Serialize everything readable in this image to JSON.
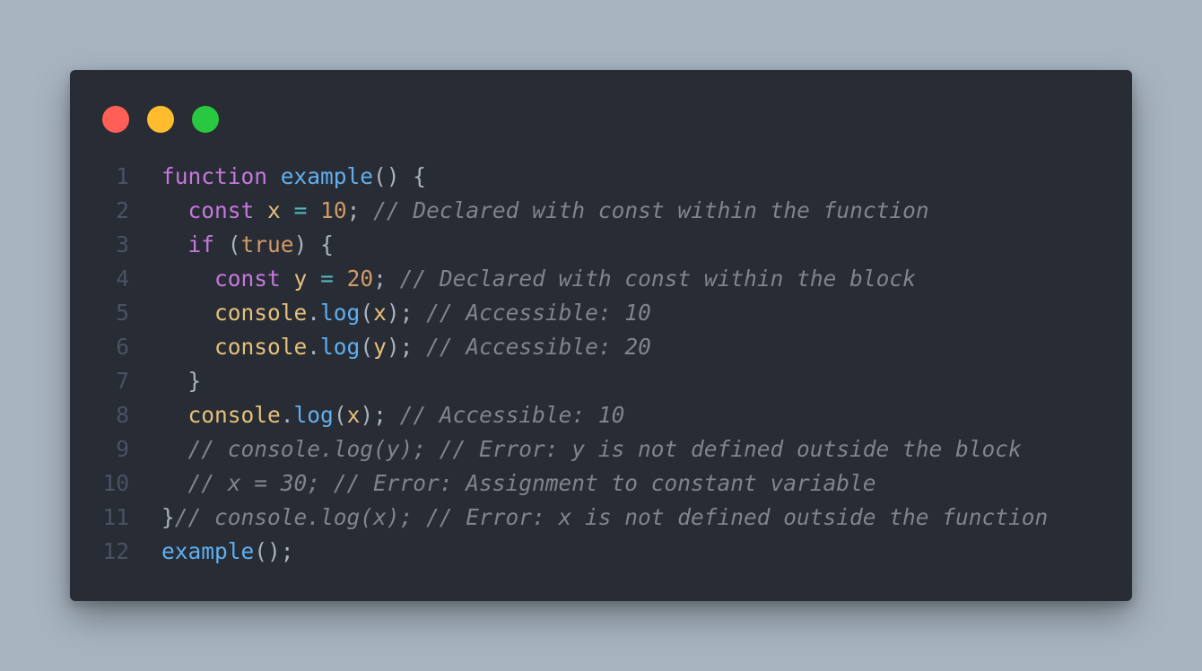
{
  "window_controls": {
    "close_color": "#ff5f57",
    "minimize_color": "#febc2e",
    "maximize_color": "#28c840"
  },
  "theme": {
    "keyword": "#c678dd",
    "function": "#61afef",
    "variable": "#e5c07b",
    "number": "#d19a66",
    "operator": "#56b6c2",
    "plain": "#abb2bf",
    "comment": "#7f848e",
    "line_number": "#4b5263"
  },
  "code": {
    "lines": [
      {
        "number": "1",
        "tokens": [
          {
            "t": "function",
            "k": "keyword"
          },
          {
            "t": " ",
            "k": "plain"
          },
          {
            "t": "example",
            "k": "function"
          },
          {
            "t": "() {",
            "k": "plain"
          }
        ]
      },
      {
        "number": "2",
        "tokens": [
          {
            "t": "  ",
            "k": "plain"
          },
          {
            "t": "const",
            "k": "keyword"
          },
          {
            "t": " ",
            "k": "plain"
          },
          {
            "t": "x",
            "k": "variable"
          },
          {
            "t": " ",
            "k": "plain"
          },
          {
            "t": "=",
            "k": "operator"
          },
          {
            "t": " ",
            "k": "plain"
          },
          {
            "t": "10",
            "k": "number"
          },
          {
            "t": "; ",
            "k": "plain"
          },
          {
            "t": "// Declared with const within the function",
            "k": "comment"
          }
        ]
      },
      {
        "number": "3",
        "tokens": [
          {
            "t": "  ",
            "k": "plain"
          },
          {
            "t": "if",
            "k": "keyword"
          },
          {
            "t": " (",
            "k": "plain"
          },
          {
            "t": "true",
            "k": "number"
          },
          {
            "t": ") {",
            "k": "plain"
          }
        ]
      },
      {
        "number": "4",
        "tokens": [
          {
            "t": "    ",
            "k": "plain"
          },
          {
            "t": "const",
            "k": "keyword"
          },
          {
            "t": " ",
            "k": "plain"
          },
          {
            "t": "y",
            "k": "variable"
          },
          {
            "t": " ",
            "k": "plain"
          },
          {
            "t": "=",
            "k": "operator"
          },
          {
            "t": " ",
            "k": "plain"
          },
          {
            "t": "20",
            "k": "number"
          },
          {
            "t": "; ",
            "k": "plain"
          },
          {
            "t": "// Declared with const within the block",
            "k": "comment"
          }
        ]
      },
      {
        "number": "5",
        "tokens": [
          {
            "t": "    ",
            "k": "plain"
          },
          {
            "t": "console",
            "k": "variable"
          },
          {
            "t": ".",
            "k": "plain"
          },
          {
            "t": "log",
            "k": "function"
          },
          {
            "t": "(",
            "k": "plain"
          },
          {
            "t": "x",
            "k": "variable"
          },
          {
            "t": "); ",
            "k": "plain"
          },
          {
            "t": "// Accessible: 10",
            "k": "comment"
          }
        ]
      },
      {
        "number": "6",
        "tokens": [
          {
            "t": "    ",
            "k": "plain"
          },
          {
            "t": "console",
            "k": "variable"
          },
          {
            "t": ".",
            "k": "plain"
          },
          {
            "t": "log",
            "k": "function"
          },
          {
            "t": "(",
            "k": "plain"
          },
          {
            "t": "y",
            "k": "variable"
          },
          {
            "t": "); ",
            "k": "plain"
          },
          {
            "t": "// Accessible: 20",
            "k": "comment"
          }
        ]
      },
      {
        "number": "7",
        "tokens": [
          {
            "t": "  }",
            "k": "plain"
          }
        ]
      },
      {
        "number": "8",
        "tokens": [
          {
            "t": "  ",
            "k": "plain"
          },
          {
            "t": "console",
            "k": "variable"
          },
          {
            "t": ".",
            "k": "plain"
          },
          {
            "t": "log",
            "k": "function"
          },
          {
            "t": "(",
            "k": "plain"
          },
          {
            "t": "x",
            "k": "variable"
          },
          {
            "t": "); ",
            "k": "plain"
          },
          {
            "t": "// Accessible: 10",
            "k": "comment"
          }
        ]
      },
      {
        "number": "9",
        "tokens": [
          {
            "t": "  ",
            "k": "plain"
          },
          {
            "t": "// console.log(y); // Error: y is not defined outside the block",
            "k": "comment"
          }
        ]
      },
      {
        "number": "10",
        "tokens": [
          {
            "t": "  ",
            "k": "plain"
          },
          {
            "t": "// x = 30; // Error: Assignment to constant variable",
            "k": "comment"
          }
        ]
      },
      {
        "number": "11",
        "tokens": [
          {
            "t": "}",
            "k": "plain"
          },
          {
            "t": "// console.log(x); // Error: x is not defined outside the function",
            "k": "comment"
          }
        ]
      },
      {
        "number": "12",
        "tokens": [
          {
            "t": "example",
            "k": "function"
          },
          {
            "t": "();",
            "k": "plain"
          }
        ]
      }
    ]
  }
}
